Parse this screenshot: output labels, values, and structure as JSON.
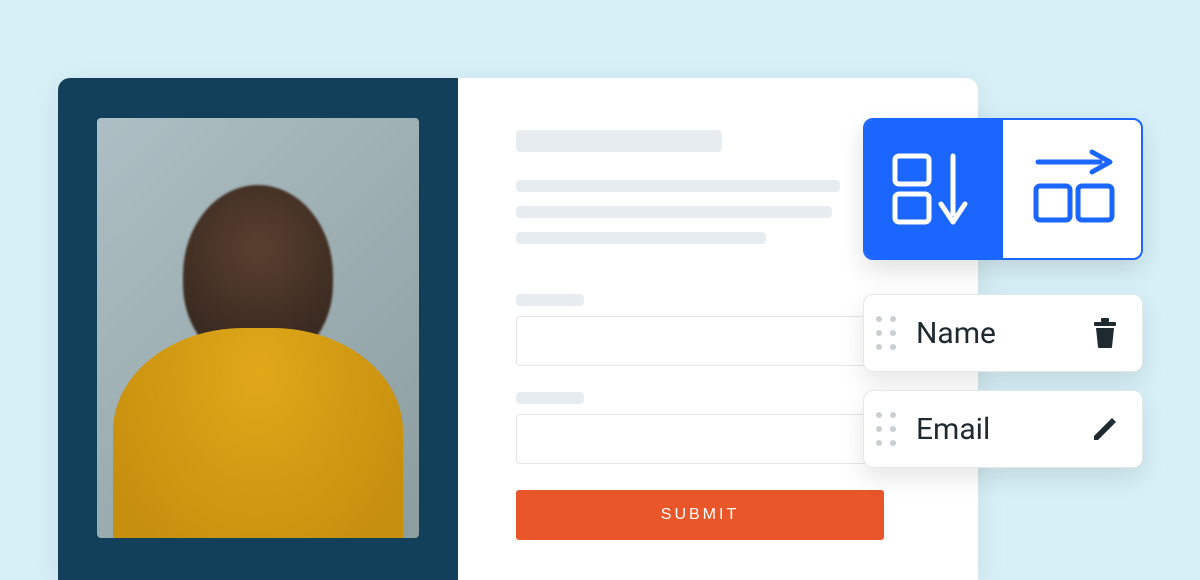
{
  "form": {
    "submit_label": "SUBMIT"
  },
  "layout_toggle": {
    "options": [
      "vertical",
      "horizontal"
    ],
    "selected": "vertical"
  },
  "fields": [
    {
      "label": "Name",
      "action_icon": "trash-icon"
    },
    {
      "label": "Email",
      "action_icon": "pencil-icon"
    }
  ],
  "colors": {
    "accent_primary": "#1a66ff",
    "accent_action": "#e8562a",
    "panel_dark": "#12405a",
    "page_bg": "#d7f0f7"
  }
}
